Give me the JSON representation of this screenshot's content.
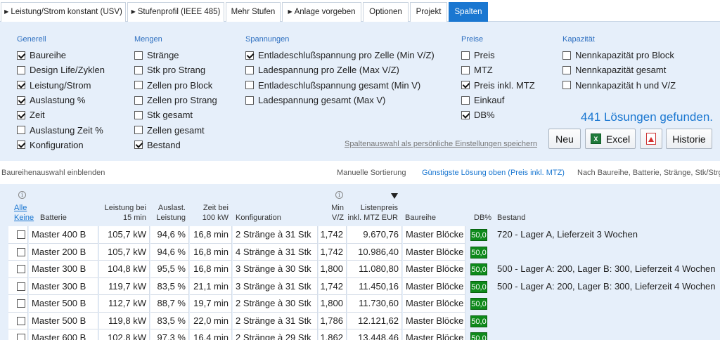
{
  "tabs": [
    {
      "label": "Leistung/Strom konstant (USV)",
      "arrow": "▶"
    },
    {
      "label": "Stufenprofil (IEEE 485)",
      "arrow": "▶"
    },
    {
      "label": "Mehr Stufen",
      "arrow": ""
    },
    {
      "label": "Anlage vorgeben",
      "arrow": "▶"
    },
    {
      "label": "Optionen",
      "arrow": ""
    },
    {
      "label": "Projekt",
      "arrow": ""
    },
    {
      "label": "Spalten",
      "arrow": "",
      "active": true
    }
  ],
  "groups": {
    "generell": {
      "title": "Generell",
      "items": [
        {
          "label": "Baureihe",
          "checked": true
        },
        {
          "label": "Design Life/Zyklen",
          "checked": false
        },
        {
          "label": "Leistung/Strom",
          "checked": true
        },
        {
          "label": "Auslastung %",
          "checked": true
        },
        {
          "label": "Zeit",
          "checked": true
        },
        {
          "label": "Auslastung Zeit %",
          "checked": false
        },
        {
          "label": "Konfiguration",
          "checked": true
        }
      ]
    },
    "mengen": {
      "title": "Mengen",
      "items": [
        {
          "label": "Stränge",
          "checked": false
        },
        {
          "label": "Stk pro Strang",
          "checked": false
        },
        {
          "label": "Zellen pro Block",
          "checked": false
        },
        {
          "label": "Zellen pro Strang",
          "checked": false
        },
        {
          "label": "Stk gesamt",
          "checked": false
        },
        {
          "label": "Zellen gesamt",
          "checked": false
        },
        {
          "label": "Bestand",
          "checked": true
        }
      ]
    },
    "spannungen": {
      "title": "Spannungen",
      "items": [
        {
          "label": "Entladeschlußspannung pro Zelle (Min V/Z)",
          "checked": true
        },
        {
          "label": "Ladespannung pro Zelle (Max V/Z)",
          "checked": false
        },
        {
          "label": "Entladeschlußspannung gesamt (Min V)",
          "checked": false
        },
        {
          "label": "Ladespannung gesamt (Max V)",
          "checked": false
        }
      ]
    },
    "preise": {
      "title": "Preise",
      "items": [
        {
          "label": "Preis",
          "checked": false
        },
        {
          "label": "MTZ",
          "checked": false
        },
        {
          "label": "Preis inkl. MTZ",
          "checked": true
        },
        {
          "label": "Einkauf",
          "checked": false
        },
        {
          "label": "DB%",
          "checked": true
        }
      ]
    },
    "kapazitaet": {
      "title": "Kapazität",
      "items": [
        {
          "label": "Nennkapazität pro Block",
          "checked": false
        },
        {
          "label": "Nennkapazität gesamt",
          "checked": false
        },
        {
          "label": "Nennkapazität h und V/Z",
          "checked": false
        }
      ]
    }
  },
  "result_text": "441 Lösungen gefunden.",
  "save_link": "Spaltenauswahl als persönliche Einstellungen speichern",
  "buttons": {
    "neu": "Neu",
    "excel": "Excel",
    "historie": "Historie"
  },
  "sortbar": {
    "show_series": "Baureihenauswahl einblenden",
    "manual": "Manuelle Sortierung",
    "cheapest": "Günstigste Lösung oben (Preis inkl. MTZ)",
    "by_series": "Nach Baureihe, Batterie, Stränge, Stk/Strg"
  },
  "table": {
    "select_all": "Alle",
    "select_none": "Keine",
    "headers": {
      "batterie": "Batterie",
      "leistung_1": "Leistung bei",
      "leistung_2": "15 min",
      "auslast_1": "Auslast.",
      "auslast_2": "Leistung",
      "zeit_1": "Zeit bei",
      "zeit_2": "100 kW",
      "konfiguration": "Konfiguration",
      "minvz_1": "Min",
      "minvz_2": "V/Z",
      "preis_1": "Listenpreis",
      "preis_2": "inkl. MTZ EUR",
      "baureihe": "Baureihe",
      "db": "DB%",
      "bestand": "Bestand"
    },
    "rows": [
      {
        "batterie": "Master 400 B",
        "leistung": "105,7 kW",
        "auslast": "94,6 %",
        "zeit": "16,8 min",
        "konfig": "2 Stränge à 31 Stk",
        "minvz": "1,742",
        "preis": "9.670,76",
        "baureihe": "Master Blöcke",
        "db": "50,0",
        "bestand": "720 - Lager A, Lieferzeit 3 Wochen"
      },
      {
        "batterie": "Master 200 B",
        "leistung": "105,7 kW",
        "auslast": "94,6 %",
        "zeit": "16,8 min",
        "konfig": "4 Stränge à 31 Stk",
        "minvz": "1,742",
        "preis": "10.986,40",
        "baureihe": "Master Blöcke",
        "db": "50,0",
        "bestand": ""
      },
      {
        "batterie": "Master 300 B",
        "leistung": "104,8 kW",
        "auslast": "95,5 %",
        "zeit": "16,8 min",
        "konfig": "3 Stränge à 30 Stk",
        "minvz": "1,800",
        "preis": "11.080,80",
        "baureihe": "Master Blöcke",
        "db": "50,0",
        "bestand": "500 - Lager A: 200, Lager B: 300, Lieferzeit 4 Wochen"
      },
      {
        "batterie": "Master 300 B",
        "leistung": "119,7 kW",
        "auslast": "83,5 %",
        "zeit": "21,1 min",
        "konfig": "3 Stränge à 31 Stk",
        "minvz": "1,742",
        "preis": "11.450,16",
        "baureihe": "Master Blöcke",
        "db": "50,0",
        "bestand": "500 - Lager A: 200, Lager B: 300, Lieferzeit 4 Wochen"
      },
      {
        "batterie": "Master 500 B",
        "leistung": "112,7 kW",
        "auslast": "88,7 %",
        "zeit": "19,7 min",
        "konfig": "2 Stränge à 30 Stk",
        "minvz": "1,800",
        "preis": "11.730,60",
        "baureihe": "Master Blöcke",
        "db": "50,0",
        "bestand": ""
      },
      {
        "batterie": "Master 500 B",
        "leistung": "119,8 kW",
        "auslast": "83,5 %",
        "zeit": "22,0 min",
        "konfig": "2 Stränge à 31 Stk",
        "minvz": "1,786",
        "preis": "12.121,62",
        "baureihe": "Master Blöcke",
        "db": "50,0",
        "bestand": ""
      },
      {
        "batterie": "Master 600 B",
        "leistung": "102,8 kW",
        "auslast": "97,3 %",
        "zeit": "16,4 min",
        "konfig": "2 Stränge à 29 Stk",
        "minvz": "1,862",
        "preis": "13.448,46",
        "baureihe": "Master Blöcke",
        "db": "50,0",
        "bestand": ""
      }
    ]
  }
}
